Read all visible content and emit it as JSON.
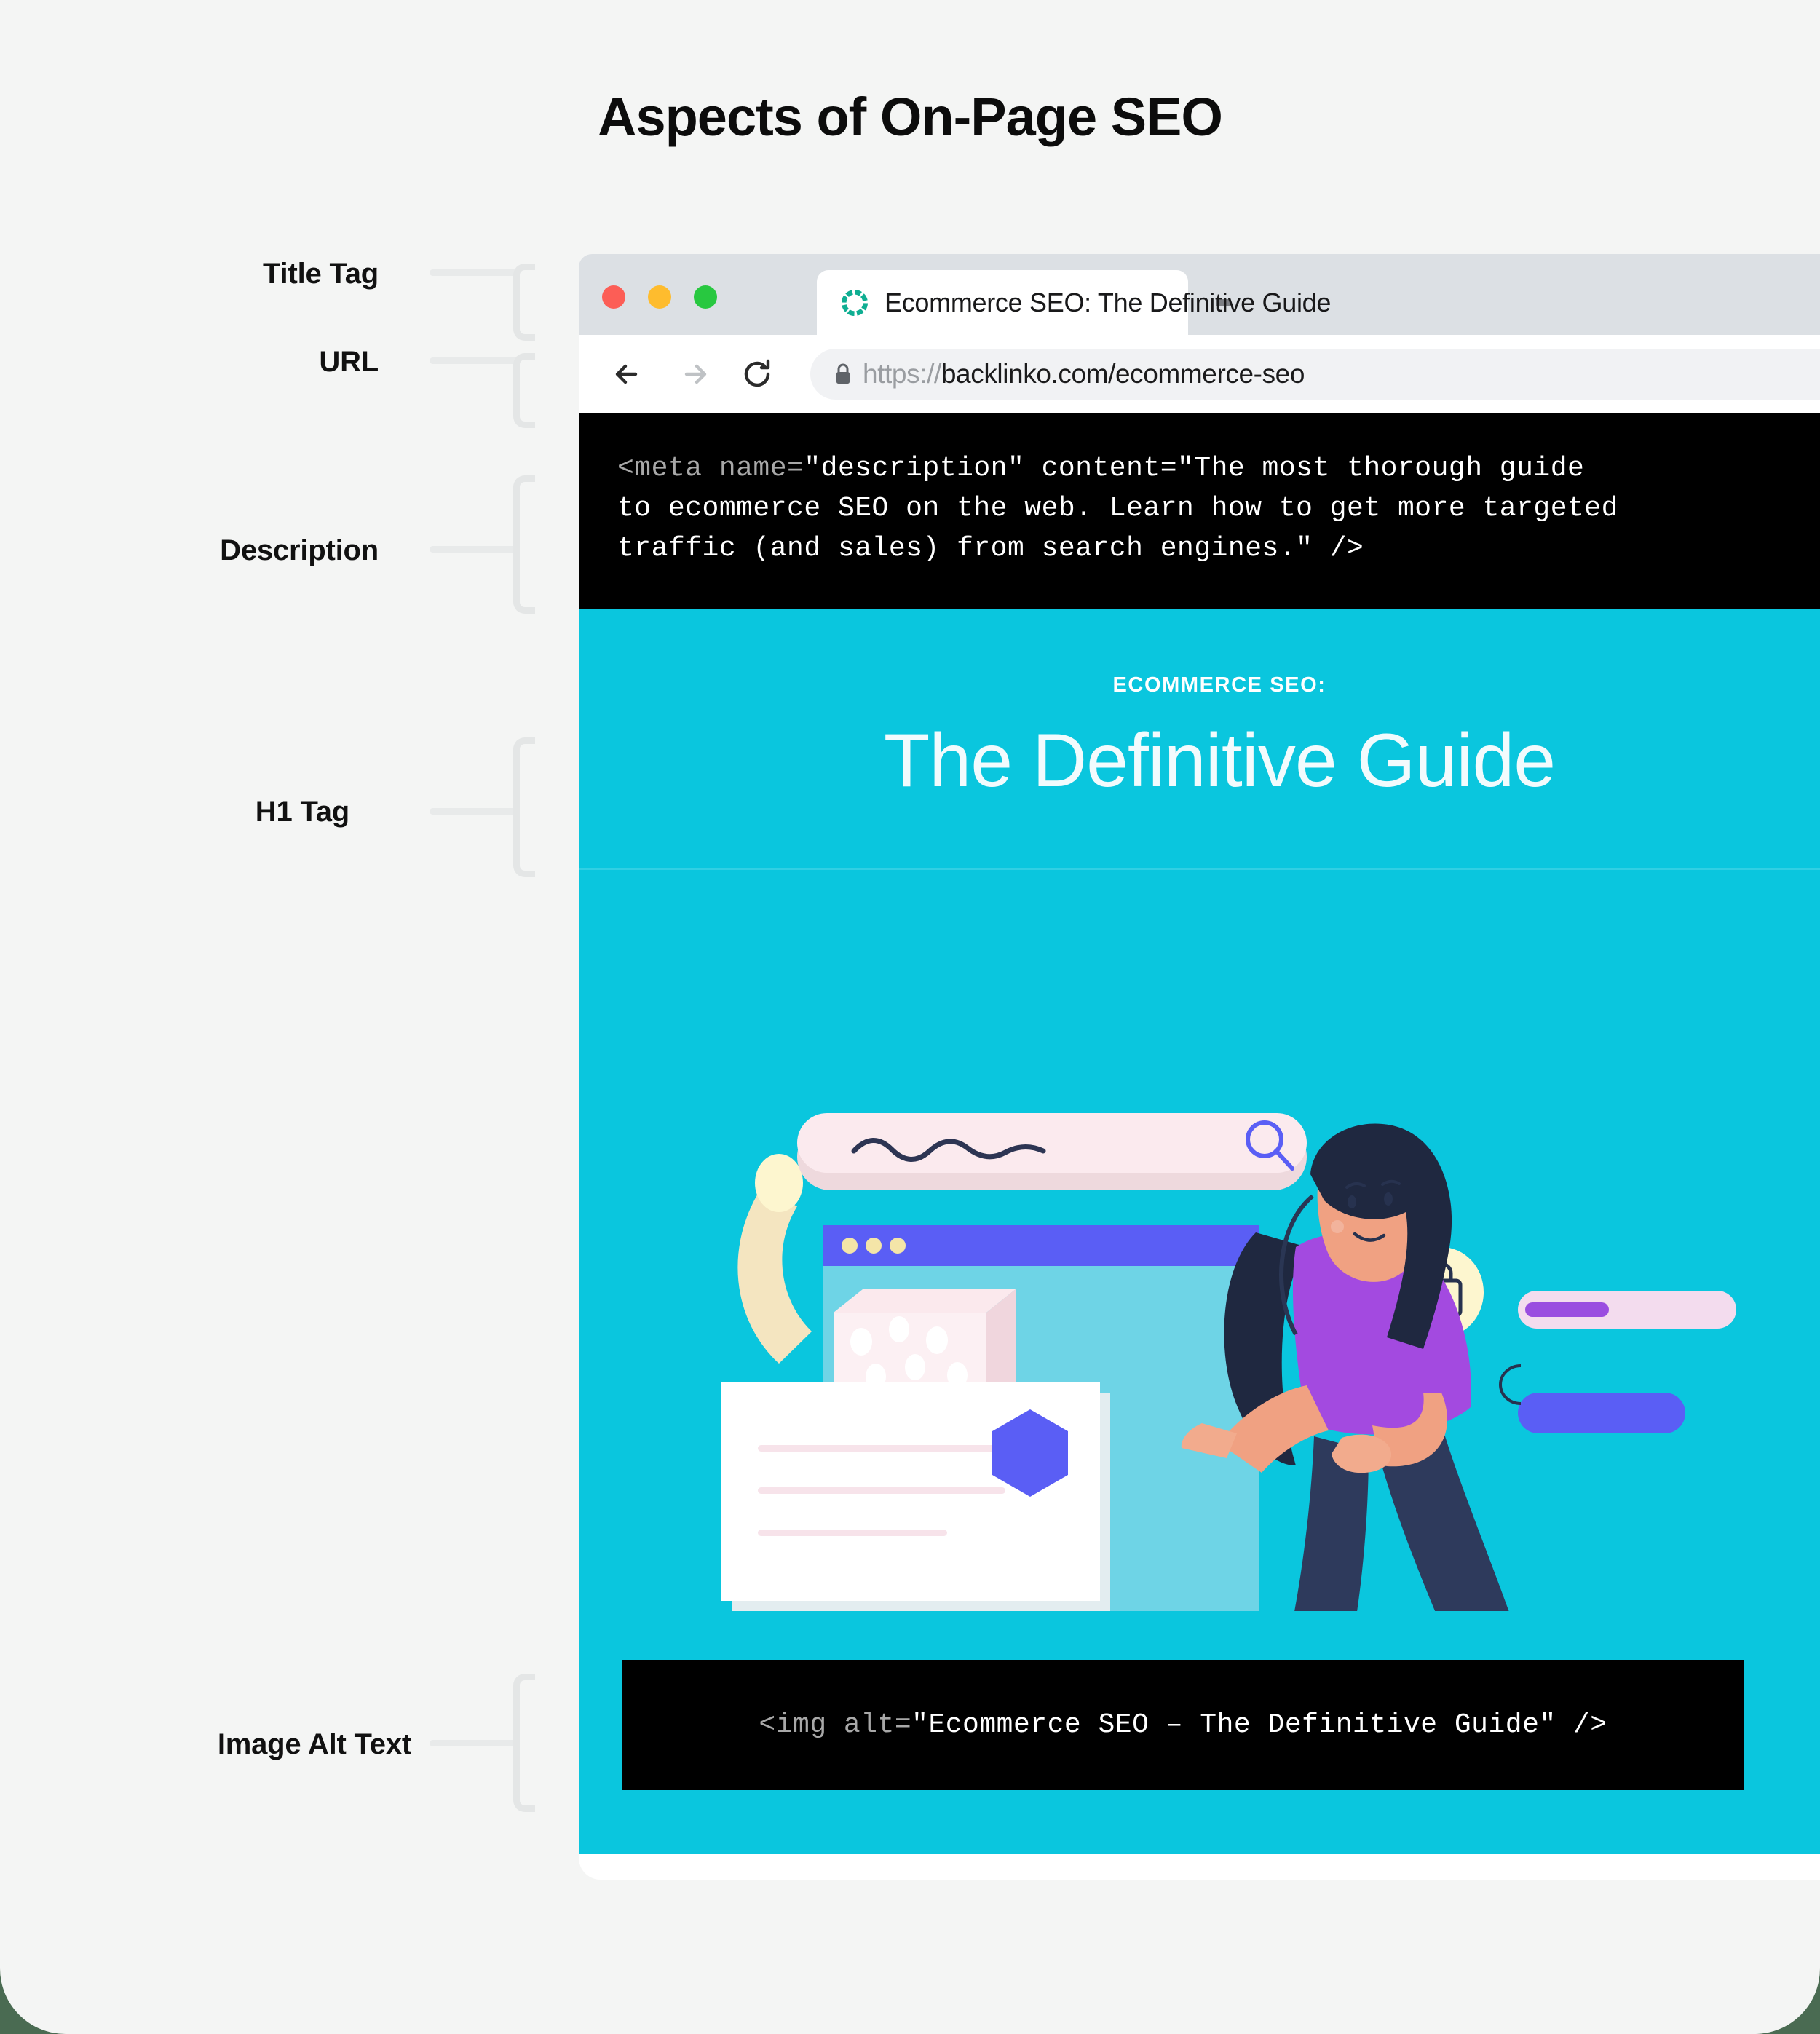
{
  "page": {
    "title": "Aspects of On-Page SEO",
    "background_color": "#f4f5f4",
    "accent_color": "#0ac6de"
  },
  "annotations": [
    {
      "id": "title-tag",
      "label": "Title Tag"
    },
    {
      "id": "url",
      "label": "URL"
    },
    {
      "id": "description",
      "label": "Description"
    },
    {
      "id": "h1-tag",
      "label": "H1 Tag"
    },
    {
      "id": "image-alt-text",
      "label": "Image Alt Text"
    }
  ],
  "browser": {
    "tab": {
      "title": "Ecommerce SEO: The Definitive Guide",
      "favicon": "teal-ring-icon"
    },
    "traffic_lights": {
      "close": "#fc5e56",
      "minimize": "#febc2e",
      "maximize": "#28c840"
    },
    "toolbar": {
      "back_icon": "arrow-left-icon",
      "forward_icon": "arrow-right-icon",
      "reload_icon": "reload-icon"
    },
    "omnibox": {
      "lock_icon": "lock-icon",
      "url_scheme": "https://",
      "url_host": "backlinko.com/ecommerce-seo"
    }
  },
  "meta_description_code": {
    "lines": [
      {
        "dim": "<meta name=",
        "text": "\"description\" content=\"The most thorough guide"
      },
      {
        "dim": "",
        "text": "to ecommerce SEO on the web. Learn how to get more targeted"
      },
      {
        "dim": "",
        "text": "traffic (and sales) from search engines.\" />"
      }
    ]
  },
  "hero": {
    "eyebrow": "ECOMMERCE SEO:",
    "heading": "The Definitive Guide",
    "background_color": "#0ac6de"
  },
  "illustration": {
    "name": "woman-ecommerce-seo-illustration",
    "search_bar": {
      "icon": "magnifier-icon",
      "squiggle": "scribble-line"
    },
    "badges": [
      {
        "name": "shopping-bag-badge",
        "icon": "shopping-bag-icon"
      },
      {
        "name": "code-card",
        "icon": "code-brackets-icon"
      }
    ]
  },
  "img_alt_code": {
    "dim": "<img alt=",
    "text": "\"Ecommerce SEO – The Definitive Guide\" />"
  }
}
